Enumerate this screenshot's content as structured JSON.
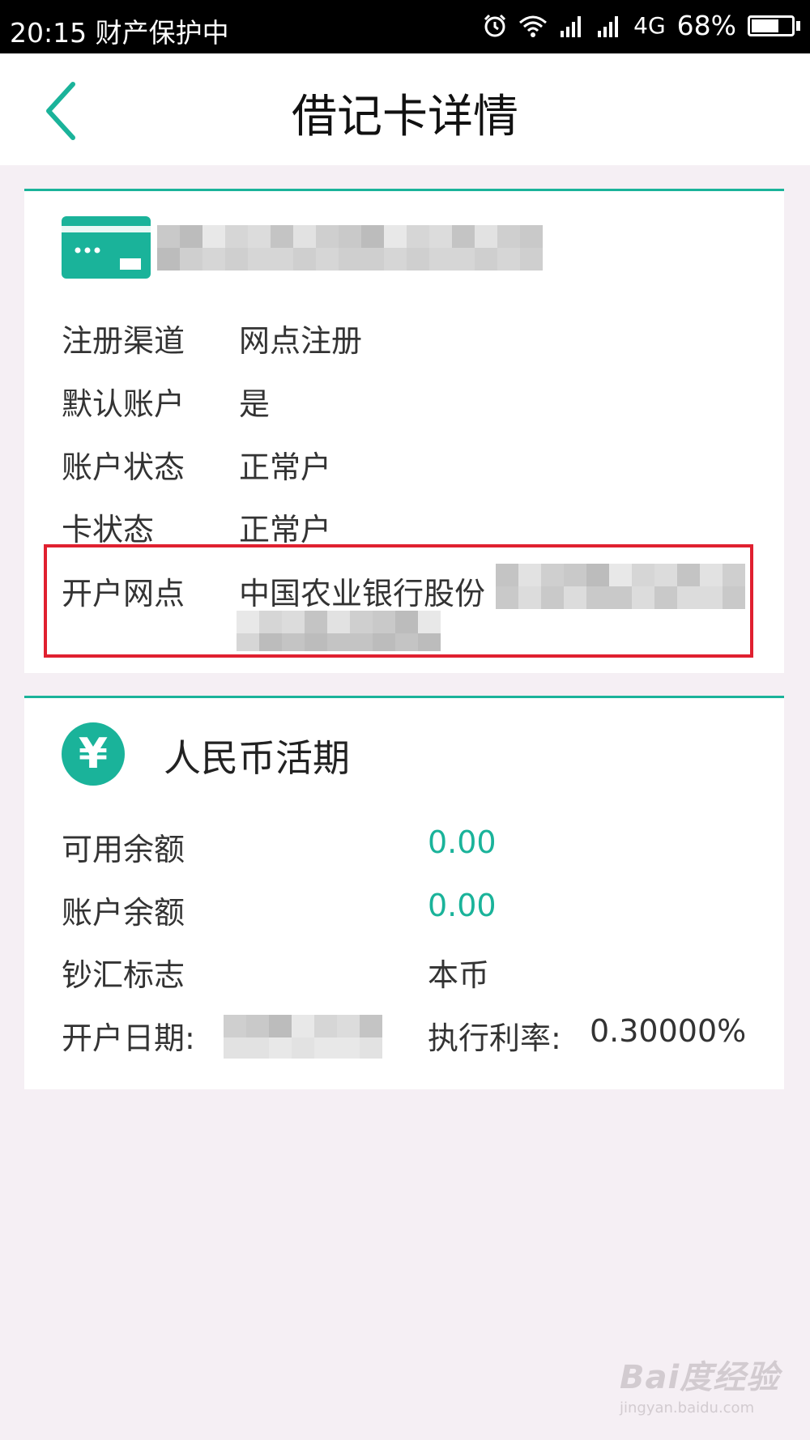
{
  "status_bar": {
    "time": "20:15",
    "label": "财产保护中",
    "network": "4G",
    "battery_percent": "68%",
    "battery_level": 0.68,
    "icons": [
      "alarm-icon",
      "wifi-icon",
      "signal-icon",
      "signal-icon"
    ]
  },
  "header": {
    "title": "借记卡详情",
    "back_icon": "chevron-left-icon"
  },
  "card_section": {
    "card_icon": "bank-card-icon",
    "rows": [
      {
        "label": "注册渠道",
        "value": "网点注册"
      },
      {
        "label": "默认账户",
        "value": "是"
      },
      {
        "label": "账户状态",
        "value": "正常户"
      },
      {
        "label": "卡状态",
        "value": "正常户"
      },
      {
        "label": "开户网点",
        "value": "中国农业银行股份"
      }
    ]
  },
  "account_section": {
    "icon": "yuan-icon",
    "icon_glyph": "¥",
    "title": "人民币活期",
    "rows": [
      {
        "label": "可用余额",
        "value": "0.00"
      },
      {
        "label": "账户余额",
        "value": "0.00"
      },
      {
        "label": "钞汇标志",
        "value": "本币"
      }
    ],
    "open_date_label": "开户日期:",
    "rate_label": "执行利率:",
    "rate_value": "0.30000%"
  },
  "watermark": {
    "logo": "Bai度经验",
    "url": "jingyan.baidu.com"
  },
  "colors": {
    "accent": "#1ab39a",
    "highlight": "#e02030",
    "background": "#f5eff4"
  }
}
